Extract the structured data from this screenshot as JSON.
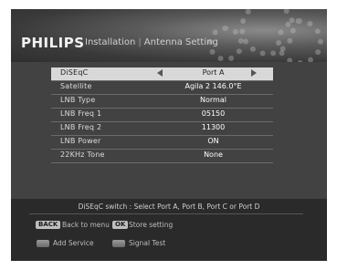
{
  "header": {
    "brand": "PHILIPS",
    "section": "Installation",
    "page": "Antenna Setting"
  },
  "menu": {
    "rows": [
      {
        "label": "DiSEqC",
        "value": "Port A"
      },
      {
        "label": "Satellite",
        "value": "Agila 2 146.0°E"
      },
      {
        "label": "LNB Type",
        "value": "Normal"
      },
      {
        "label": "LNB Freq 1",
        "value": "05150"
      },
      {
        "label": "LNB Freq 2",
        "value": "11300"
      },
      {
        "label": "LNB Power",
        "value": "ON"
      },
      {
        "label": "22KHz Tone",
        "value": "None"
      }
    ]
  },
  "footer": {
    "hint": "DiSEqC switch : Select Port A, Port B, Port C or Port D",
    "back_key": "BACK",
    "back_text": "Back to menu",
    "ok_key": "OK",
    "ok_text": "Store setting",
    "red_text": "Add Service",
    "green_text": "Signal Test"
  }
}
